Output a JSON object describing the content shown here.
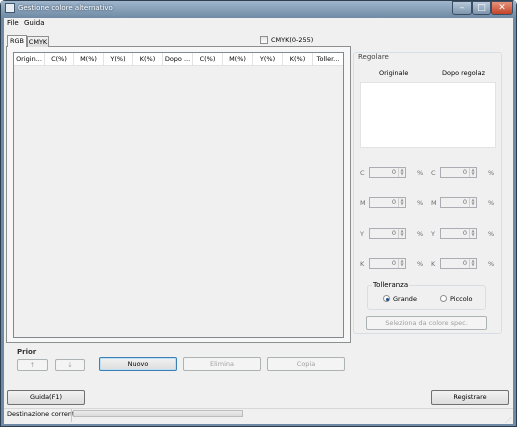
{
  "window": {
    "title": "Gestione colore alternativo"
  },
  "menu": {
    "file": "File",
    "guida": "Guida"
  },
  "tabs": [
    {
      "label": "RGB"
    },
    {
      "label": "CMYK"
    }
  ],
  "cmyk_checkbox": {
    "label": "CMYK(0-255)",
    "checked": false
  },
  "list": {
    "columns": [
      "Origin...",
      "C(%)",
      "M(%)",
      "Y(%)",
      "K(%)",
      "Dopo ...",
      "C(%)",
      "M(%)",
      "Y(%)",
      "K(%)",
      "Toller..."
    ]
  },
  "prior": {
    "label": "Prior",
    "up": "↑",
    "down": "↓"
  },
  "actions": {
    "nuovo": "Nuovo",
    "elimina": "Elimina",
    "copia": "Copia"
  },
  "regolare": {
    "title": "Regolare",
    "originale": "Originale",
    "dopo": "Dopo regolaz",
    "rows": [
      {
        "label": "C",
        "left_value": "0",
        "right_value": "0",
        "unit": "%"
      },
      {
        "label": "M",
        "left_value": "0",
        "right_value": "0",
        "unit": "%"
      },
      {
        "label": "Y",
        "left_value": "0",
        "right_value": "0",
        "unit": "%"
      },
      {
        "label": "K",
        "left_value": "0",
        "right_value": "0",
        "unit": "%"
      }
    ],
    "tolleranza": {
      "title": "Tolleranza",
      "grande": "Grande",
      "piccolo": "Piccolo",
      "selected": "Grande"
    },
    "seleziona": "Seleziona da colore spec."
  },
  "footer": {
    "guida": "Guida(F1)",
    "registrare": "Registrare"
  },
  "status": {
    "text": "Destinazione corrente"
  }
}
